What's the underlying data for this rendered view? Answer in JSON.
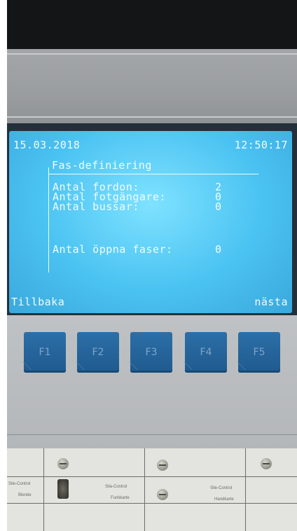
{
  "screen": {
    "date": "15.03.2018",
    "time": "12:50:17",
    "title": "Fas-definiering",
    "rows": [
      {
        "label": "Antal fordon:",
        "value": "2"
      },
      {
        "label": "Antal fotgängare:",
        "value": "0"
      },
      {
        "label": "Antal bussar:",
        "value": "0"
      }
    ],
    "open_phases": {
      "label": "Antal öppna faser:",
      "value": "0"
    },
    "softkeys": {
      "left": "Tillbaka",
      "right": "nästa"
    }
  },
  "function_keys": [
    "F1",
    "F2",
    "F3",
    "F4",
    "F5"
  ],
  "terminal_labels": {
    "a": "Sile-Control",
    "b": "Blende",
    "c": "Sila-Control",
    "d": "Funkkarte",
    "e": "Sile-Control",
    "f": "Handkarte"
  },
  "colors": {
    "screen_backlight": "#4bc3f2",
    "screen_text": "#f2fbff",
    "function_key": "#2c6fa8"
  }
}
